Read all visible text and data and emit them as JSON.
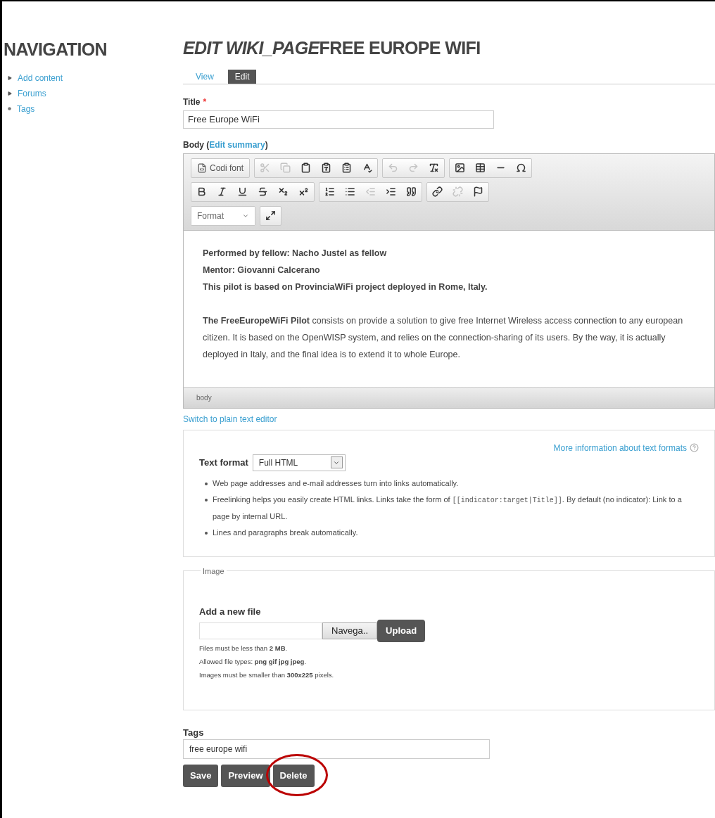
{
  "sidebar": {
    "title": "NAVIGATION",
    "items": [
      {
        "label": "Add content",
        "expanded": false
      },
      {
        "label": "Forums",
        "expanded": false
      },
      {
        "label": "Tags",
        "leaf": true
      }
    ]
  },
  "page": {
    "title_prefix": "EDIT WIKI_PAGE",
    "title": "FREE EUROPE WIFI"
  },
  "tabs": [
    {
      "label": "View",
      "selected": false
    },
    {
      "label": "Edit",
      "selected": true
    }
  ],
  "title_field": {
    "label": "Title",
    "required_mark": "*",
    "value": "Free Europe WiFi"
  },
  "body": {
    "label": "Body (",
    "link": "Edit summary",
    "label_end": ")",
    "toolbar": [
      [
        [
          {
            "kind": "source",
            "label": "Codi font",
            "disabled": false
          }
        ],
        [
          {
            "kind": "cut",
            "disabled": true
          },
          {
            "kind": "copy",
            "disabled": true
          },
          {
            "kind": "paste",
            "disabled": false
          },
          {
            "kind": "paste-text",
            "disabled": false
          },
          {
            "kind": "paste-word",
            "disabled": false
          },
          {
            "kind": "spell",
            "disabled": false
          }
        ],
        [
          {
            "kind": "undo",
            "disabled": true
          },
          {
            "kind": "redo",
            "disabled": true
          },
          {
            "kind": "clear-format",
            "disabled": false
          }
        ],
        [
          {
            "kind": "image",
            "disabled": false
          },
          {
            "kind": "table",
            "disabled": false
          },
          {
            "kind": "hr",
            "disabled": false
          },
          {
            "kind": "omega",
            "disabled": false
          }
        ]
      ],
      [
        [
          {
            "kind": "bold",
            "disabled": false
          },
          {
            "kind": "italic",
            "disabled": false
          },
          {
            "kind": "underline",
            "disabled": false
          },
          {
            "kind": "strike",
            "disabled": false
          },
          {
            "kind": "sub",
            "disabled": false
          },
          {
            "kind": "sup",
            "disabled": false
          }
        ],
        [
          {
            "kind": "ol",
            "disabled": false
          },
          {
            "kind": "ul",
            "disabled": false
          },
          {
            "kind": "outdent",
            "disabled": true
          },
          {
            "kind": "indent",
            "disabled": false
          },
          {
            "kind": "quote",
            "disabled": false
          }
        ],
        [
          {
            "kind": "link",
            "disabled": false
          },
          {
            "kind": "unlink",
            "disabled": true
          },
          {
            "kind": "anchor",
            "disabled": false
          }
        ]
      ],
      [
        [
          {
            "kind": "format",
            "label": "Format",
            "disabled": false
          }
        ],
        [
          {
            "kind": "maximize",
            "disabled": false
          }
        ]
      ]
    ],
    "content": [
      {
        "lines": [
          "Performed by fellow: Nacho Justel as fellow",
          "Mentor: Giovanni Calcerano",
          "This pilot is based on ProvinciaWiFi project deployed in Rome, Italy."
        ],
        "bold": true
      },
      {
        "lines": [
          "**The FreeEuropeWiFi Pilot** consists on provide a solution to give free Internet Wireless access connection to any european citizen. It is based on the OpenWISP system, and relies on the connection-sharing of its users. By the way, it is actually deployed in Italy, and the final idea is to extend it to whole Europe."
        ],
        "bold": false
      }
    ],
    "path": "body",
    "switch_link": "Switch to plain text editor"
  },
  "text_format": {
    "label": "Text format",
    "value": "Full HTML",
    "more_link": "More information about text formats",
    "tips": [
      {
        "text": "Web page addresses and e-mail addresses turn into links automatically."
      },
      {
        "text": "Freelinking helps you easily create HTML links. Links take the form of ",
        "code": "[[indicator:target|Title]]",
        "after": ". By default (no indicator): Link to a page by internal URL."
      },
      {
        "text": "Lines and paragraphs break automatically."
      }
    ]
  },
  "image": {
    "legend": "Image",
    "label": "Add a new file",
    "browse": "Navega..",
    "upload": "Upload",
    "hints": [
      "Files must be less than **2 MB**.",
      "Allowed file types: **png gif jpg jpeg**.",
      "Images must be smaller than **300x225** pixels."
    ]
  },
  "tags": {
    "label": "Tags",
    "value": "free europe wifi"
  },
  "actions": [
    {
      "label": "Save",
      "highlighted": false
    },
    {
      "label": "Preview",
      "highlighted": false
    },
    {
      "label": "Delete",
      "highlighted": true
    }
  ]
}
